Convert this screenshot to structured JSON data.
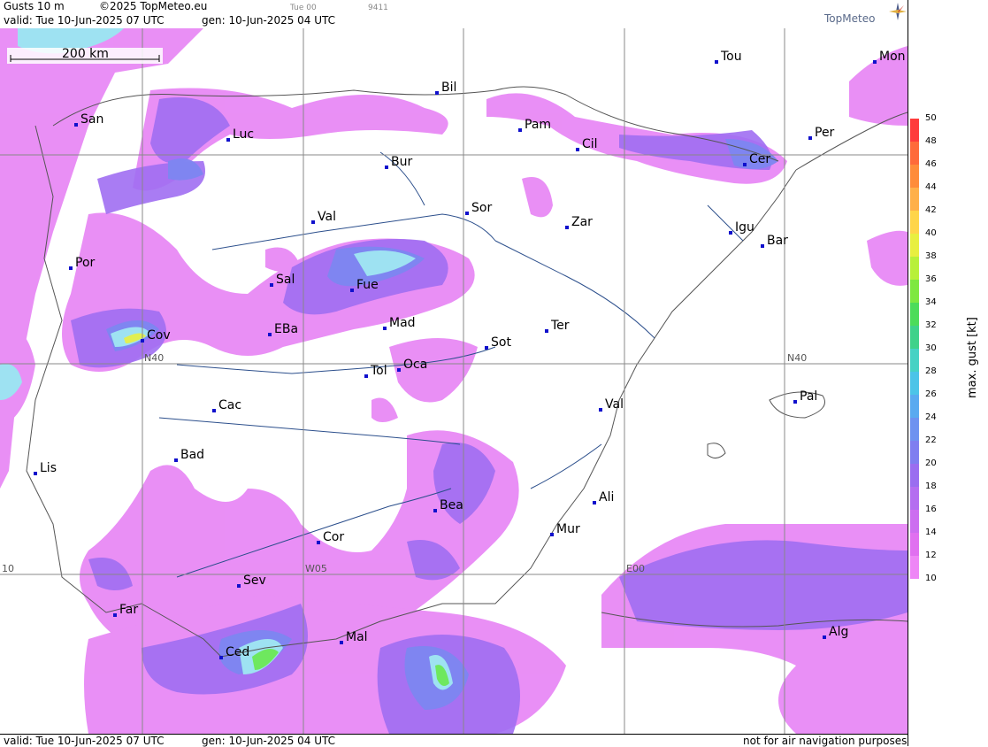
{
  "header": {
    "product": "Gusts 10 m",
    "copyright": "©2025 TopMeteo.eu",
    "valid": "valid:  Tue  10-Jun-2025  07 UTC",
    "gen": "gen: 10-Jun-2025 04 UTC",
    "run": "Tue 00",
    "code": "9411",
    "brand": "TopMeteo"
  },
  "footer": {
    "valid": "valid:  Tue  10-Jun-2025  07 UTC",
    "gen": "gen: 10-Jun-2025 04 UTC",
    "note": "not for air navigation purposes"
  },
  "scale_bar": "200 km",
  "grid_labels": {
    "lat40_left": "N40",
    "lat40_right": "N40",
    "lon0": "E00",
    "lon5": "W05",
    "lon10": "10"
  },
  "cities": [
    {
      "name": "Tou"
    },
    {
      "name": "Mon"
    },
    {
      "name": "Bil"
    },
    {
      "name": "San"
    },
    {
      "name": "Pam"
    },
    {
      "name": "Luc"
    },
    {
      "name": "Cil"
    },
    {
      "name": "Per"
    },
    {
      "name": "Cer"
    },
    {
      "name": "Bur"
    },
    {
      "name": "Sor"
    },
    {
      "name": "Val"
    },
    {
      "name": "Zar"
    },
    {
      "name": "Igu"
    },
    {
      "name": "Bar"
    },
    {
      "name": "Por"
    },
    {
      "name": "Sal"
    },
    {
      "name": "Fue"
    },
    {
      "name": "Mad"
    },
    {
      "name": "EBa"
    },
    {
      "name": "Cov"
    },
    {
      "name": "Ter"
    },
    {
      "name": "Sot"
    },
    {
      "name": "Tol"
    },
    {
      "name": "Oca"
    },
    {
      "name": "Pal"
    },
    {
      "name": "Cac"
    },
    {
      "name": "Val"
    },
    {
      "name": "Bad"
    },
    {
      "name": "Lis"
    },
    {
      "name": "Bea"
    },
    {
      "name": "Ali"
    },
    {
      "name": "Mur"
    },
    {
      "name": "Cor"
    },
    {
      "name": "Sev"
    },
    {
      "name": "Far"
    },
    {
      "name": "Mal"
    },
    {
      "name": "Alg"
    },
    {
      "name": "Ced"
    }
  ],
  "legend": {
    "title": "max. gust  [kt]",
    "ticks": [
      "50",
      "48",
      "46",
      "44",
      "42",
      "40",
      "38",
      "36",
      "34",
      "32",
      "30",
      "28",
      "26",
      "24",
      "22",
      "20",
      "18",
      "16",
      "14",
      "12",
      "10"
    ],
    "colors": [
      "#ff3b3b",
      "#ff6a3a",
      "#ff8c3a",
      "#ffb04a",
      "#ffd54a",
      "#e8ef40",
      "#b8f03a",
      "#7ee840",
      "#4cdc5a",
      "#3fd28a",
      "#46d2c4",
      "#4cc4e8",
      "#5aaaf0",
      "#6e92f0",
      "#7f7ef0",
      "#9a6ef0",
      "#b46ef0",
      "#cc6ef0",
      "#e070f0",
      "#ee86f6"
    ]
  },
  "colors": {
    "weak": "#e783f5",
    "mid": "#a06ef2",
    "strong": "#7c86f0",
    "cyan": "#9ee2f2",
    "green": "#6ee85e",
    "yellow": "#e2ef52",
    "water": "#ffffff",
    "coast": "#555555",
    "river": "#2c4f8c",
    "grid": "#888888"
  }
}
